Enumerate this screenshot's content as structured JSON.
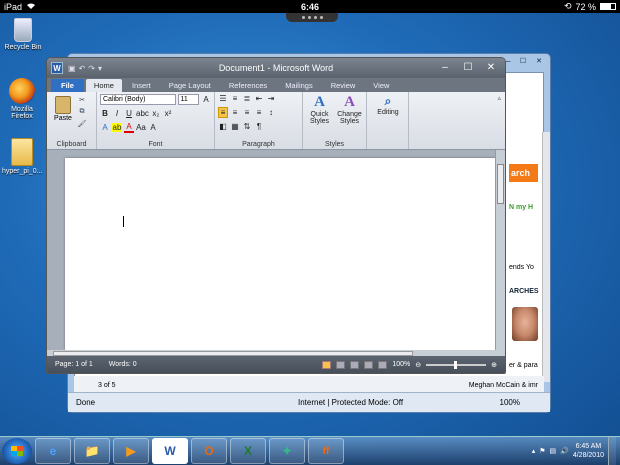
{
  "ipad": {
    "device": "iPad",
    "time": "6:46",
    "battery": "72 %"
  },
  "desktop_icons": [
    {
      "label": "Recycle Bin"
    },
    {
      "label": "Mozilla Firefox"
    },
    {
      "label": "hyper_pi_0..."
    }
  ],
  "ie": {
    "search_suffix": "ρ",
    "orange_text": "arch",
    "snippets": [
      "N my H",
      "ends Yo",
      "ARCHES",
      "er & para"
    ],
    "pager": "3 of 5",
    "bottom_link": "Meghan McCain & imr",
    "status_left": "Done",
    "zone": "Internet | Protected Mode: Off",
    "zoom": "100%"
  },
  "word": {
    "title": "Document1 - Microsoft Word",
    "tabs": [
      "File",
      "Home",
      "Insert",
      "Page Layout",
      "References",
      "Mailings",
      "Review",
      "View"
    ],
    "active_tab": "Home",
    "font_name": "Calibri (Body)",
    "font_size": "11",
    "clipboard_label": "Clipboard",
    "paste_label": "Paste",
    "font_label": "Font",
    "paragraph_label": "Paragraph",
    "styles_label": "Styles",
    "quick_styles": "Quick Styles",
    "change_styles": "Change Styles",
    "editing": "Editing",
    "page_info": "Page: 1 of 1",
    "words": "Words: 0",
    "zoom": "100%"
  },
  "taskbar": {
    "apps": [
      "e",
      "📁",
      "▶",
      "W",
      "O",
      "X",
      "✦",
      "ff"
    ],
    "time": "6:45 AM",
    "date": "4/28/2010"
  },
  "colors": {
    "desktop": "#1f6bb8",
    "word_file_tab": "#2f6fc4",
    "ie_orange": "#f47a17"
  }
}
